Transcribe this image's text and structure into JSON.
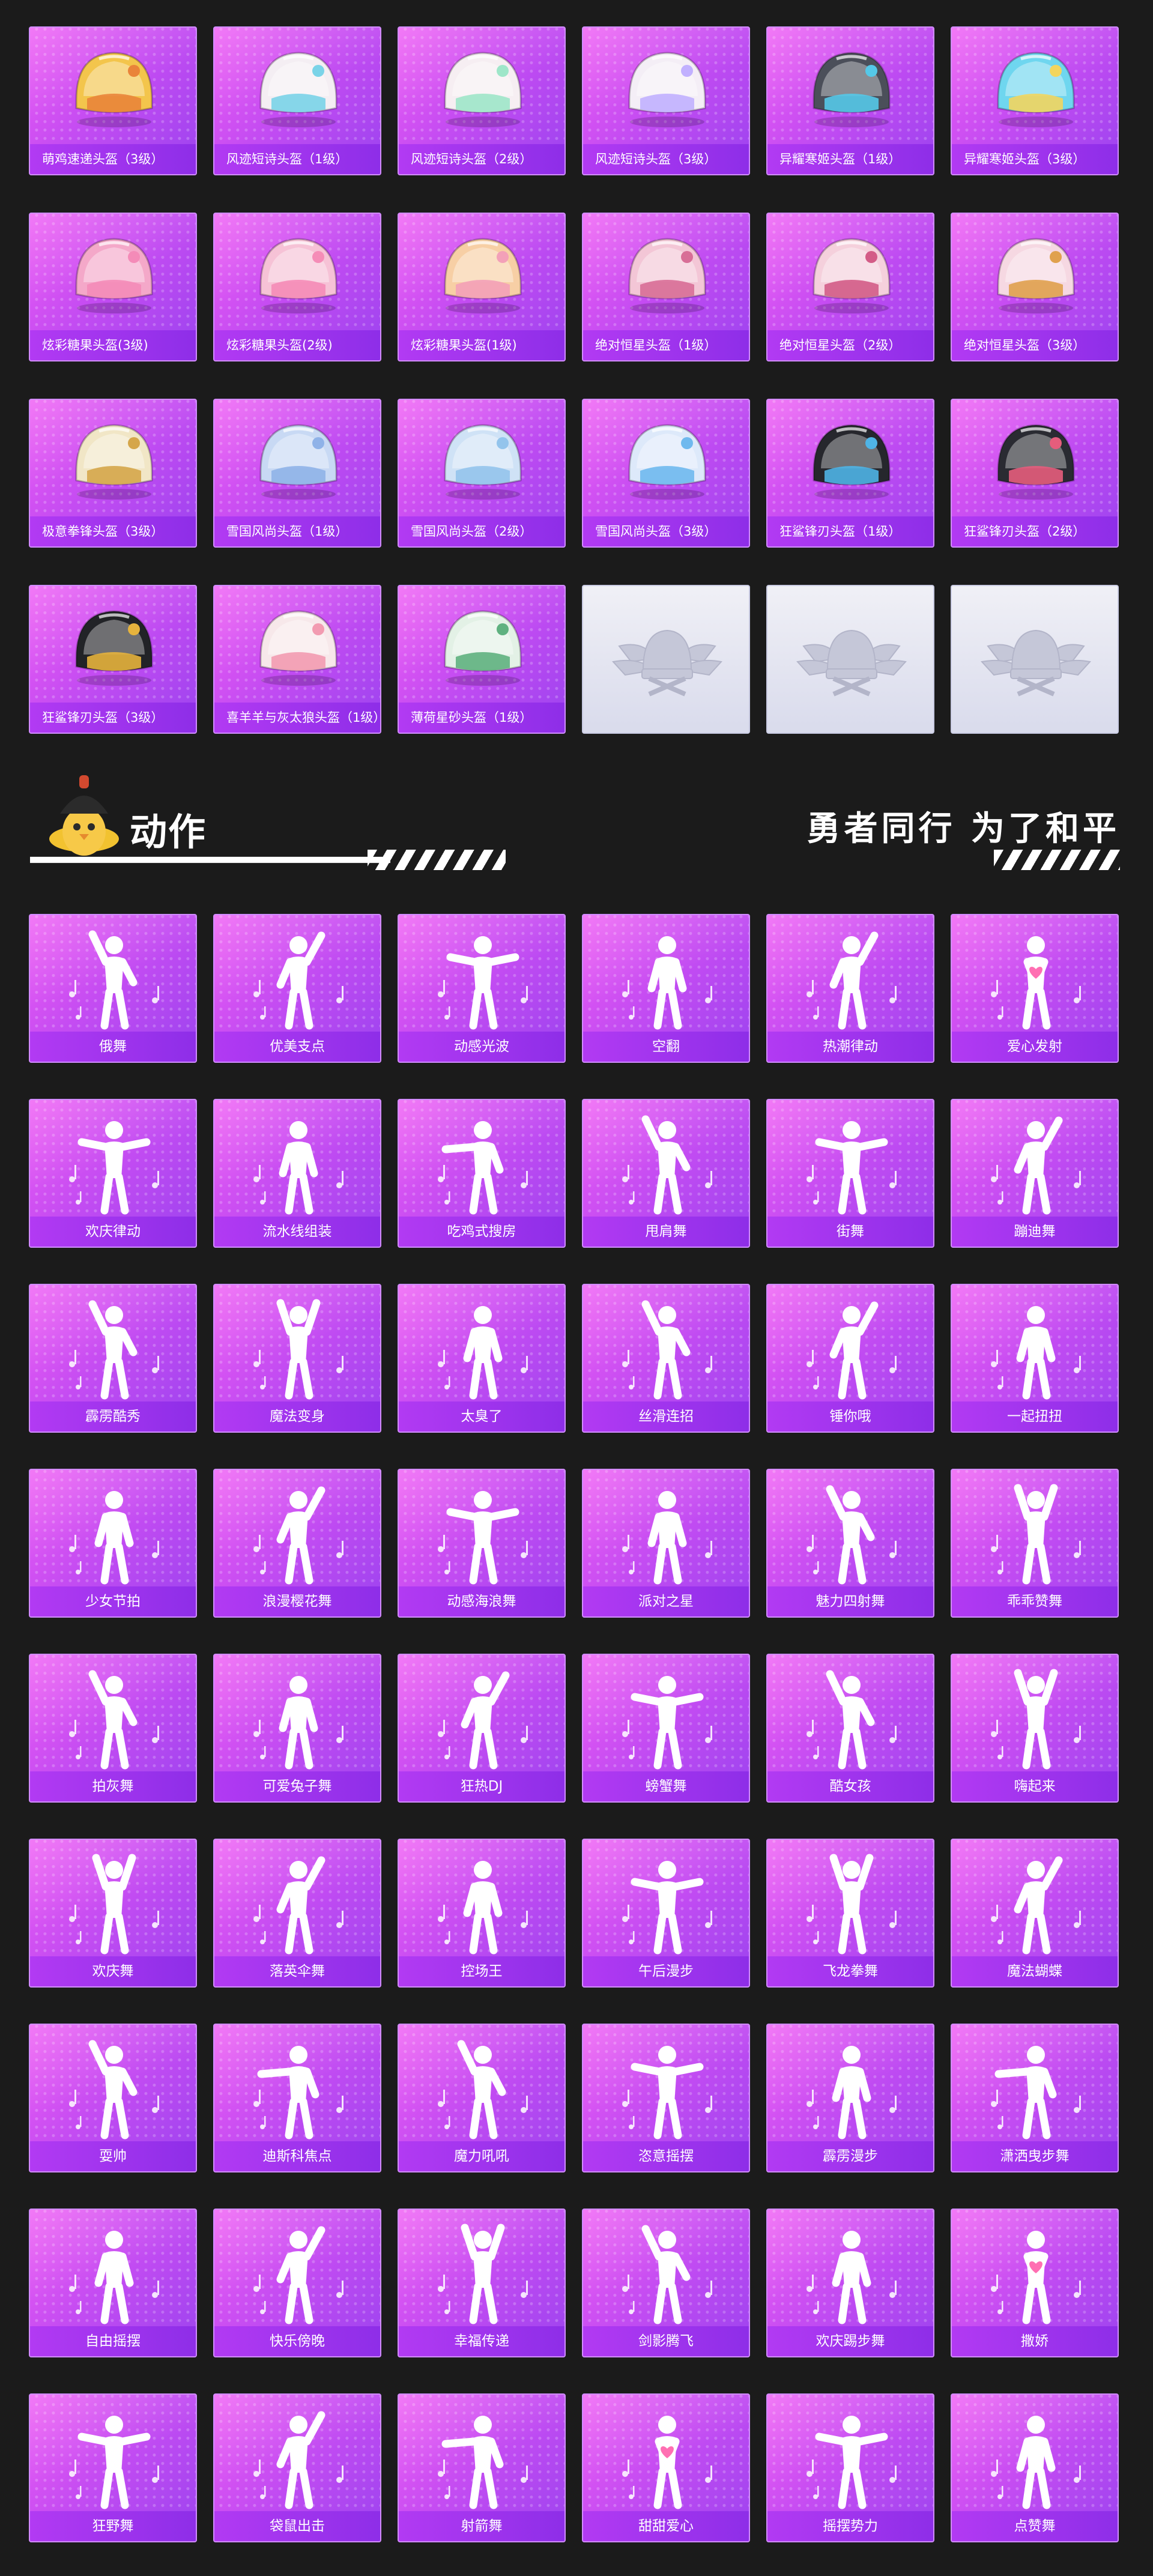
{
  "helmets": [
    {
      "label": "萌鸡速递头盔（3级）",
      "color": "#f3c54c",
      "accent": "#e9843a",
      "icon": "helmet-icon"
    },
    {
      "label": "风迹短诗头盔（1级）",
      "color": "#f4eef3",
      "accent": "#7ad3e8",
      "icon": "helmet-icon"
    },
    {
      "label": "风迹短诗头盔（2级）",
      "color": "#f6eef2",
      "accent": "#9ee6c9",
      "icon": "helmet-icon"
    },
    {
      "label": "风迹短诗头盔（3级）",
      "color": "#f4eef6",
      "accent": "#c1b0ff",
      "icon": "helmet-icon"
    },
    {
      "label": "异耀寒姬头盔（1级）",
      "color": "#4b4f5a",
      "accent": "#55c8e8",
      "icon": "helmet-icon"
    },
    {
      "label": "异耀寒姬头盔（3级）",
      "color": "#6fd6ef",
      "accent": "#f2d55e",
      "icon": "helmet-icon"
    },
    {
      "label": "炫彩糖果头盔(3级)",
      "color": "#f4a8c9",
      "accent": "#f48bb8",
      "icon": "helmet-icon"
    },
    {
      "label": "炫彩糖果头盔(2级)",
      "color": "#f6c2d6",
      "accent": "#f58cb7",
      "icon": "helmet-icon"
    },
    {
      "label": "炫彩糖果头盔(1级)",
      "color": "#f7cfa5",
      "accent": "#f3a0b8",
      "icon": "helmet-icon"
    },
    {
      "label": "绝对恒星头盔（1级）",
      "color": "#f3c6d6",
      "accent": "#d86e97",
      "icon": "helmet-icon"
    },
    {
      "label": "绝对恒星头盔（2级）",
      "color": "#f5d0dc",
      "accent": "#d35c87",
      "icon": "helmet-icon"
    },
    {
      "label": "绝对恒星头盔（3级）",
      "color": "#f6d8e2",
      "accent": "#e0a14e",
      "icon": "helmet-icon"
    },
    {
      "label": "极意拳锋头盔（3级）",
      "color": "#f1e6c6",
      "accent": "#d5a64a",
      "icon": "helmet-icon"
    },
    {
      "label": "雪国风尚头盔（1级）",
      "color": "#c8d9f4",
      "accent": "#8fb2e8",
      "icon": "helmet-icon"
    },
    {
      "label": "雪国风尚头盔（2级）",
      "color": "#cfe2f6",
      "accent": "#93c4ec",
      "icon": "helmet-icon"
    },
    {
      "label": "雪国风尚头盔（3级）",
      "color": "#dde9fa",
      "accent": "#6fb9ee",
      "icon": "helmet-icon"
    },
    {
      "label": "狂鲨锋刃头盔（1级）",
      "color": "#26272d",
      "accent": "#4fb4e6",
      "icon": "helmet-icon"
    },
    {
      "label": "狂鲨锋刃头盔（2级）",
      "color": "#2a2b32",
      "accent": "#e55d7c",
      "icon": "helmet-icon"
    },
    {
      "label": "狂鲨锋刃头盔（3级）",
      "color": "#222327",
      "accent": "#e6b33d",
      "icon": "helmet-icon"
    },
    {
      "label": "喜羊羊与灰太狼头盔（1级）",
      "color": "#f7e8ea",
      "accent": "#f29bb1",
      "icon": "helmet-icon"
    },
    {
      "label": "薄荷星砂头盔（1级）",
      "color": "#e3f1e6",
      "accent": "#5fb180",
      "icon": "helmet-icon"
    }
  ],
  "placeholders": 3,
  "section": {
    "title": "动作",
    "slogan": "勇者同行 为了和平"
  },
  "emotes": [
    {
      "label": "俄舞",
      "pose": "arm-up-left"
    },
    {
      "label": "优美支点",
      "pose": "arm-up-right"
    },
    {
      "label": "动感光波",
      "pose": "arms-wide"
    },
    {
      "label": "空翻",
      "pose": "arms-down"
    },
    {
      "label": "热潮律动",
      "pose": "arm-up-right"
    },
    {
      "label": "爱心发射",
      "pose": "heart"
    },
    {
      "label": "欢庆律动",
      "pose": "arms-wide"
    },
    {
      "label": "流水线组装",
      "pose": "arms-down"
    },
    {
      "label": "吃鸡式搜房",
      "pose": "point"
    },
    {
      "label": "甩肩舞",
      "pose": "arm-up-left"
    },
    {
      "label": "街舞",
      "pose": "arms-wide"
    },
    {
      "label": "蹦迪舞",
      "pose": "arm-up-right"
    },
    {
      "label": "霹雳酷秀",
      "pose": "arm-up-left"
    },
    {
      "label": "魔法变身",
      "pose": "arms-up"
    },
    {
      "label": "太臭了",
      "pose": "arms-down"
    },
    {
      "label": "丝滑连招",
      "pose": "arm-up-left"
    },
    {
      "label": "锤你哦",
      "pose": "arm-up-right"
    },
    {
      "label": "一起扭扭",
      "pose": "arms-down"
    },
    {
      "label": "少女节拍",
      "pose": "arms-down"
    },
    {
      "label": "浪漫樱花舞",
      "pose": "arm-up-right"
    },
    {
      "label": "动感海浪舞",
      "pose": "arms-wide"
    },
    {
      "label": "派对之星",
      "pose": "arms-down"
    },
    {
      "label": "魅力四射舞",
      "pose": "arm-up-left"
    },
    {
      "label": "乖乖赞舞",
      "pose": "arms-up"
    },
    {
      "label": "拍灰舞",
      "pose": "arm-up-left"
    },
    {
      "label": "可爱兔子舞",
      "pose": "arms-down"
    },
    {
      "label": "狂热DJ",
      "pose": "arm-up-right"
    },
    {
      "label": "螃蟹舞",
      "pose": "arms-wide"
    },
    {
      "label": "酷女孩",
      "pose": "arm-up-left"
    },
    {
      "label": "嗨起来",
      "pose": "arms-up"
    },
    {
      "label": "欢庆舞",
      "pose": "arms-up"
    },
    {
      "label": "落英伞舞",
      "pose": "arm-up-right"
    },
    {
      "label": "控场王",
      "pose": "arms-down"
    },
    {
      "label": "午后漫步",
      "pose": "arms-wide"
    },
    {
      "label": "飞龙拳舞",
      "pose": "arms-up"
    },
    {
      "label": "魔法蝴蝶",
      "pose": "arm-up-right"
    },
    {
      "label": "耍帅",
      "pose": "arm-up-left"
    },
    {
      "label": "迪斯科焦点",
      "pose": "point"
    },
    {
      "label": "魔力吼吼",
      "pose": "arm-up-left"
    },
    {
      "label": "恣意摇摆",
      "pose": "arms-wide"
    },
    {
      "label": "霹雳漫步",
      "pose": "arms-down"
    },
    {
      "label": "潇洒曳步舞",
      "pose": "point"
    },
    {
      "label": "自由摇摆",
      "pose": "arms-down"
    },
    {
      "label": "快乐傍晚",
      "pose": "arm-up-right"
    },
    {
      "label": "幸福传递",
      "pose": "arms-up"
    },
    {
      "label": "剑影腾飞",
      "pose": "arm-up-left"
    },
    {
      "label": "欢庆踢步舞",
      "pose": "arms-down"
    },
    {
      "label": "撒娇",
      "pose": "heart"
    },
    {
      "label": "狂野舞",
      "pose": "arms-wide"
    },
    {
      "label": "袋鼠出击",
      "pose": "arm-up-right"
    },
    {
      "label": "射箭舞",
      "pose": "point"
    },
    {
      "label": "甜甜爱心",
      "pose": "heart"
    },
    {
      "label": "摇摆势力",
      "pose": "arms-wide"
    },
    {
      "label": "点赞舞",
      "pose": "arms-down"
    }
  ]
}
